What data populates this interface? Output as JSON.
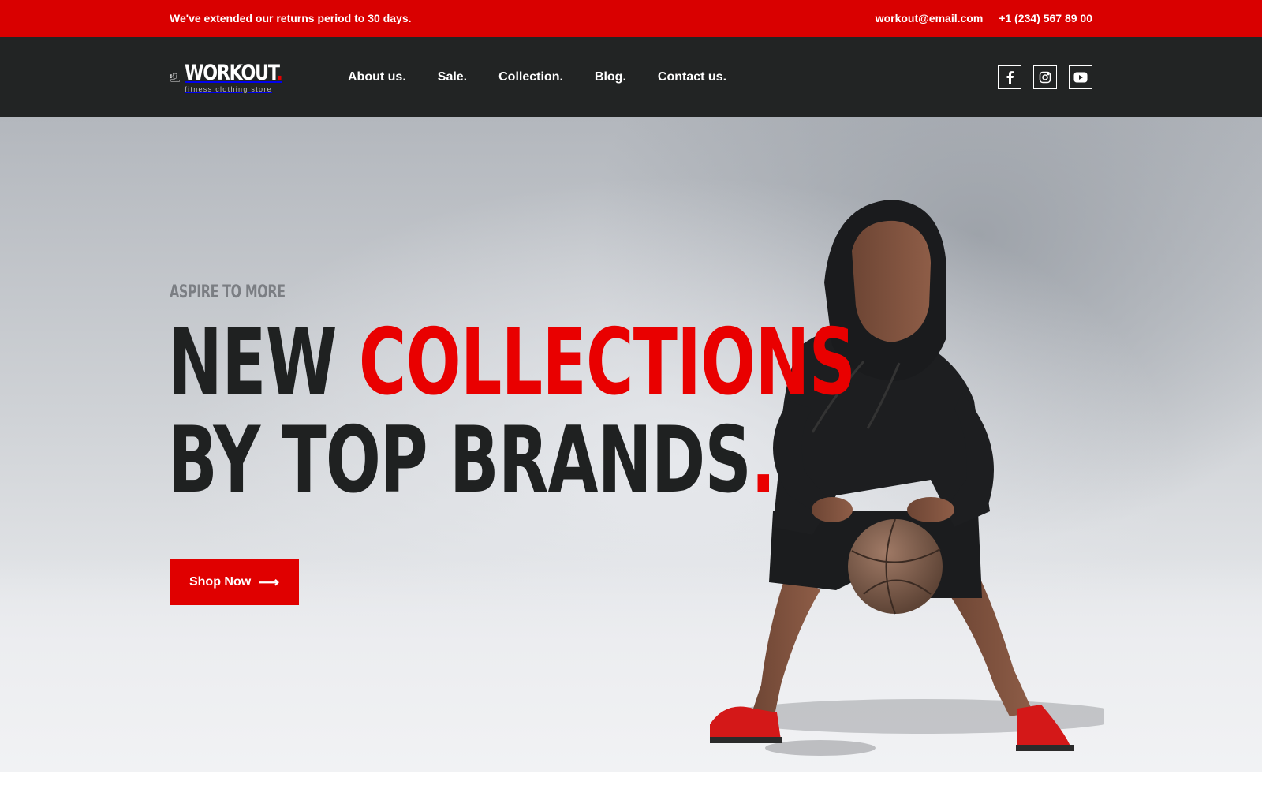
{
  "topbar": {
    "notice": "We've extended our returns period to 30 days.",
    "email": "workout@email.com",
    "phone": "+1 (234) 567 89 00"
  },
  "header": {
    "logo": {
      "name": "WORKOUT",
      "dot": ".",
      "tagline": "fitness clothing store",
      "icon": "gym-shirt-shoe-icon"
    },
    "nav": [
      {
        "label": "About us."
      },
      {
        "label": "Sale."
      },
      {
        "label": "Collection."
      },
      {
        "label": "Blog."
      },
      {
        "label": "Contact us."
      }
    ],
    "social": [
      {
        "icon": "facebook-icon"
      },
      {
        "icon": "instagram-icon"
      },
      {
        "icon": "youtube-icon"
      }
    ]
  },
  "hero": {
    "eyebrow": "ASPIRE TO MORE",
    "line1_dark": "NEW ",
    "line1_red": "COLLECTIONS",
    "line2_dark": "BY TOP BRANDS",
    "line2_red": ".",
    "cta_label": "Shop Now",
    "cta_icon": "arrow-right-icon",
    "image": "basketball-player-photo"
  },
  "colors": {
    "accent": "#e00000",
    "topbar_bg": "#d90000",
    "header_bg": "#222424",
    "headline_dark": "#1f2121"
  }
}
